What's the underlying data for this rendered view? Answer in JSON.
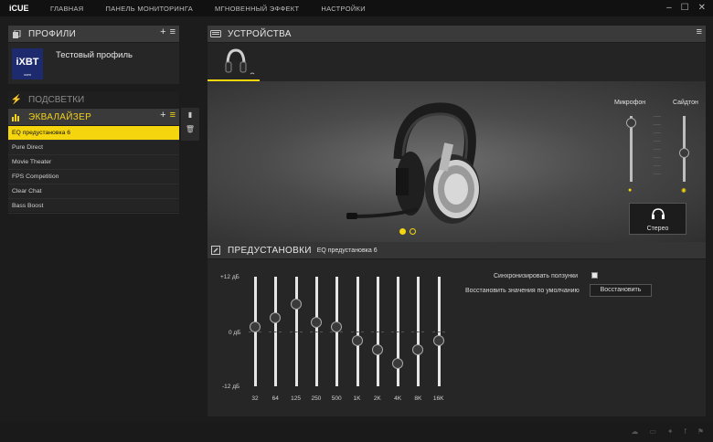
{
  "app": {
    "title": "iCUE"
  },
  "nav": [
    "ГЛАВНАЯ",
    "ПАНЕЛЬ МОНИТОРИНГА",
    "МГНОВЕННЫЙ ЭФФЕКТ",
    "НАСТРОЙКИ"
  ],
  "window_controls": {
    "minimize": "–",
    "maximize": "☐",
    "close": "✕"
  },
  "profiles": {
    "title": "ПРОФИЛИ",
    "add": "+",
    "menu": "≡",
    "item": {
      "logo": "iXBT",
      "logo_sub": "com",
      "name": "Тестовый профиль"
    }
  },
  "lighting": {
    "title": "ПОДСВЕТКИ"
  },
  "equalizer": {
    "title": "ЭКВАЛАЙЗЕР",
    "add": "+",
    "menu": "≡",
    "presets": [
      "EQ предустановка 6",
      "Pure Direct",
      "Movie Theater",
      "FPS Competition",
      "Clear Chat",
      "Bass Boost"
    ],
    "selected_index": 0
  },
  "devices": {
    "title": "УСТРОЙСТВА",
    "menu": "≡"
  },
  "mixer": {
    "mic_label": "Микрофон",
    "sidetone_label": "Сайдтон",
    "mic_level": 0.9,
    "sidetone_level": 0.45,
    "stereo_label": "Стерео"
  },
  "carousel": {
    "pages": 2,
    "current": 1
  },
  "presets_panel": {
    "title": "ПРЕДУСТАНОВКИ",
    "current": "EQ предустановка 6",
    "db_top": "+12 дБ",
    "db_mid": "0 дБ",
    "db_bottom": "-12 дБ",
    "sync_label": "Синхронизировать ползунки",
    "sync_checked": true,
    "restore_label": "Восстановить значения по умолчанию",
    "restore_button": "Восстановить",
    "bands": [
      {
        "freq": "32",
        "gain": 1
      },
      {
        "freq": "64",
        "gain": 3
      },
      {
        "freq": "125",
        "gain": 6
      },
      {
        "freq": "250",
        "gain": 2
      },
      {
        "freq": "500",
        "gain": 1
      },
      {
        "freq": "1K",
        "gain": -2
      },
      {
        "freq": "2K",
        "gain": -4
      },
      {
        "freq": "4K",
        "gain": -7
      },
      {
        "freq": "8K",
        "gain": -4
      },
      {
        "freq": "16K",
        "gain": -2
      }
    ]
  },
  "colors": {
    "accent": "#f5d50e",
    "panel": "#3a3a3a",
    "background": "#1c1c1c"
  }
}
